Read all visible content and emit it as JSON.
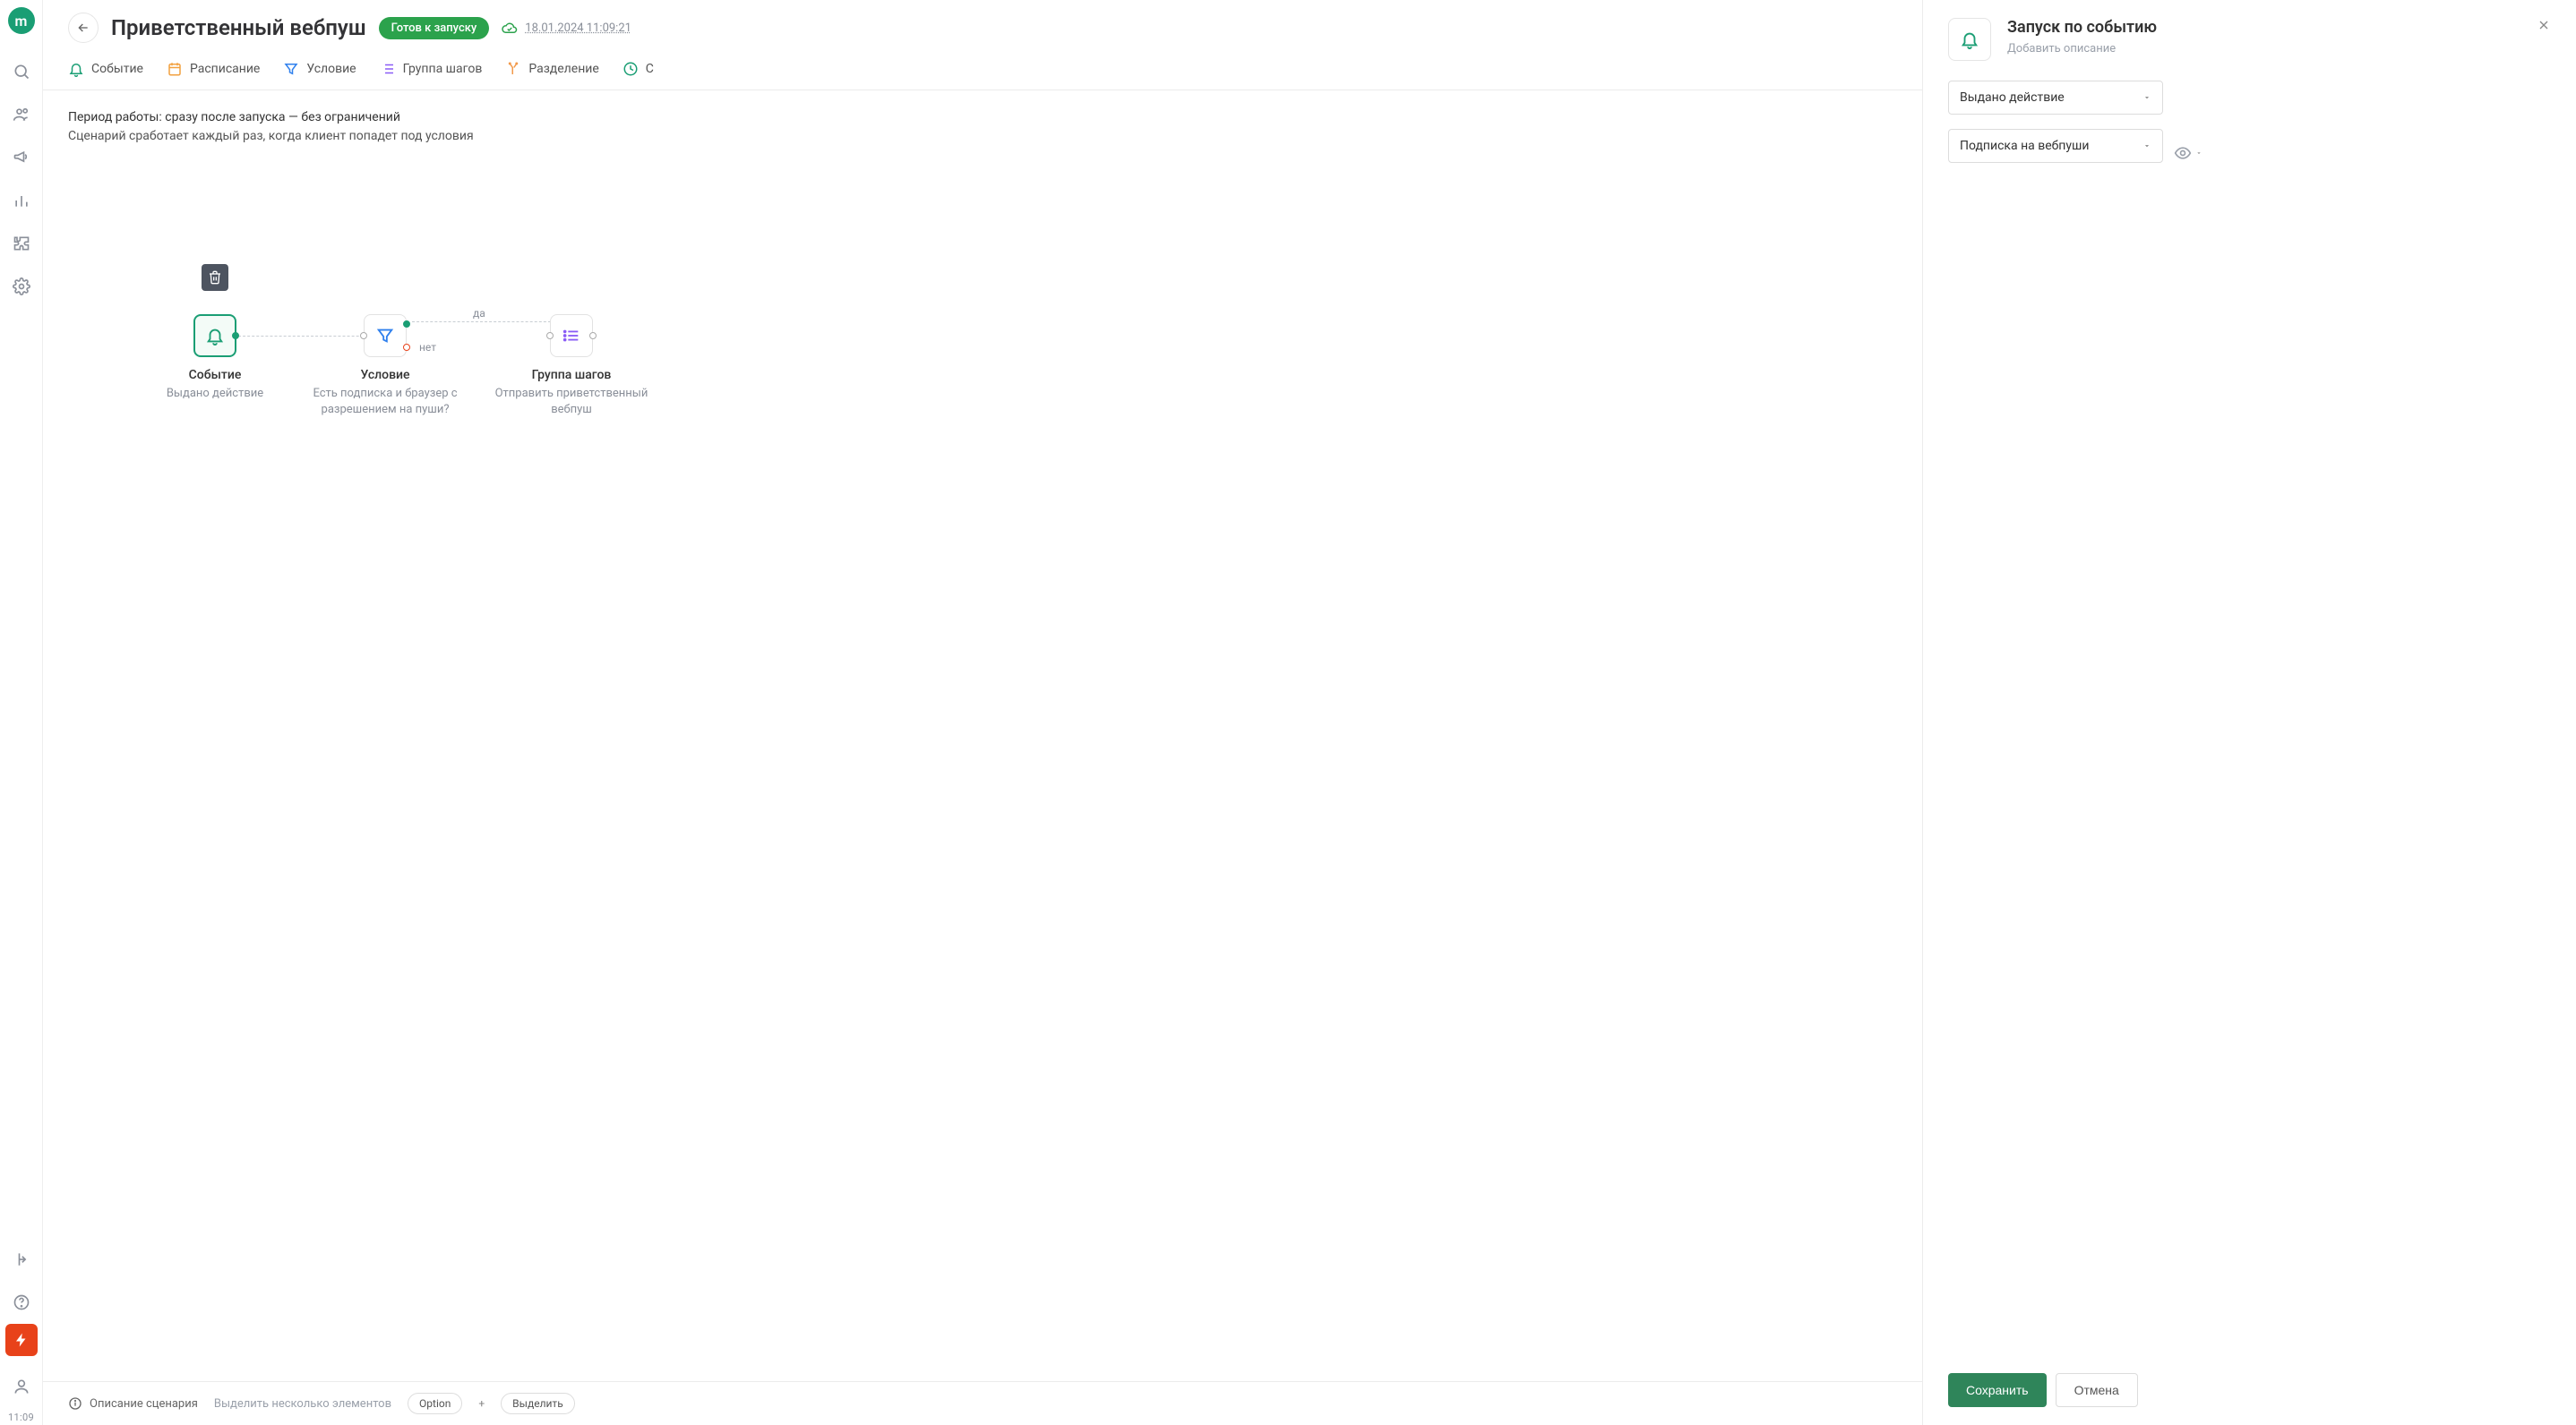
{
  "sidebar": {
    "logo": "m",
    "time": "11:09"
  },
  "header": {
    "title": "Приветственный вебпуш",
    "status": "Готов к запуску",
    "timestamp": "18.01.2024 11:09:21"
  },
  "toolbar": {
    "items": [
      {
        "label": "Событие"
      },
      {
        "label": "Расписание"
      },
      {
        "label": "Условие"
      },
      {
        "label": "Группа шагов"
      },
      {
        "label": "Разделение"
      },
      {
        "label": "С"
      }
    ]
  },
  "canvas": {
    "line1": "Период работы: сразу после запуска — без ограничений",
    "line2": "Сценарий сработает каждый раз, когда клиент попадет под условия",
    "labels": {
      "yes": "да",
      "no": "нет"
    },
    "nodes": {
      "event": {
        "title": "Событие",
        "sub": "Выдано действие"
      },
      "cond": {
        "title": "Условие",
        "sub": "Есть подписка и браузер с разрешением на пуши?"
      },
      "group": {
        "title": "Группа шагов",
        "sub": "Отправить приветственный вебпуш"
      }
    }
  },
  "footer": {
    "desc": "Описание сценария",
    "hint": "Выделить несколько элементов",
    "key": "Option",
    "plus": "+",
    "action": "Выделить"
  },
  "panel": {
    "title": "Запуск по событию",
    "subtitle": "Добавить описание",
    "selects": {
      "action": "Выдано действие",
      "event": "Подписка на вебпуши"
    },
    "buttons": {
      "save": "Сохранить",
      "cancel": "Отмена"
    }
  }
}
